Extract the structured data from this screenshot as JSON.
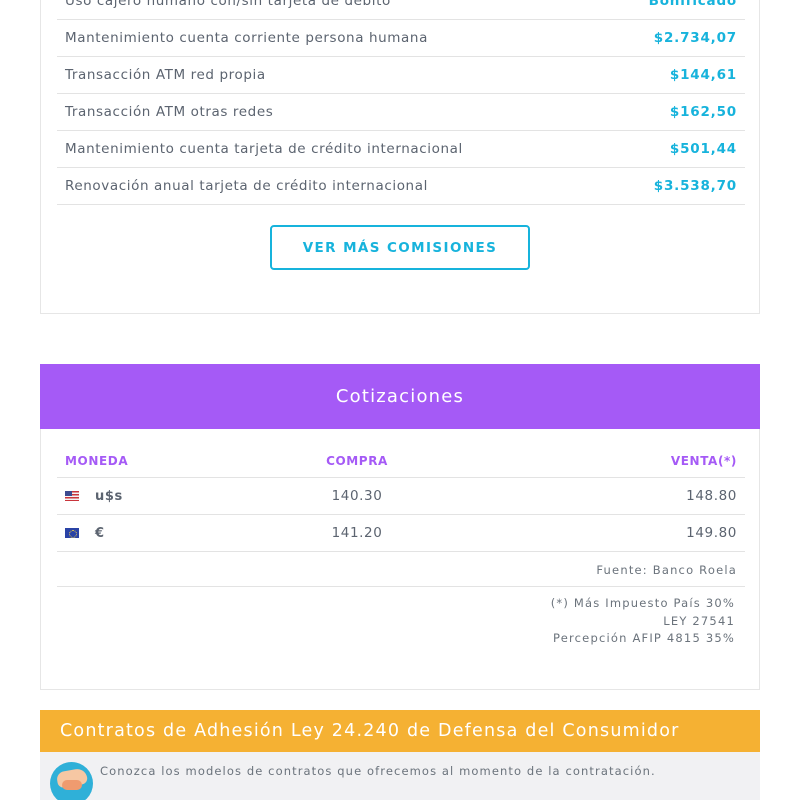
{
  "fees": {
    "rows": [
      {
        "name": "Uso cajero humano con/sin tarjeta de débito",
        "value": "Bonificado"
      },
      {
        "name": "Mantenimiento cuenta corriente persona humana",
        "value": "$2.734,07"
      },
      {
        "name": "Transacción ATM red propia",
        "value": "$144,61"
      },
      {
        "name": "Transacción ATM otras redes",
        "value": "$162,50"
      },
      {
        "name": "Mantenimiento cuenta tarjeta de crédito internacional",
        "value": "$501,44"
      },
      {
        "name": "Renovación anual tarjeta de crédito internacional",
        "value": "$3.538,70"
      }
    ],
    "more_button": "VER MÁS COMISIONES"
  },
  "quotes": {
    "title": "Cotizaciones",
    "headers": {
      "currency": "MONEDA",
      "buy": "COMPRA",
      "sell": "VENTA(*)"
    },
    "rows": [
      {
        "flag": "us-flag-icon",
        "symbol": "u$s",
        "buy": "140.30",
        "sell": "148.80"
      },
      {
        "flag": "eu-flag-icon",
        "symbol": "€",
        "buy": "141.20",
        "sell": "149.80"
      }
    ],
    "source": "Fuente: Banco Roela",
    "notes": [
      "(*) Más Impuesto País 30%",
      "LEY 27541",
      "Percepción AFIP 4815 35%"
    ]
  },
  "contracts": {
    "title": "Contratos de Adhesión Ley 24.240 de Defensa del Consumidor",
    "text": "Conozca los modelos de contratos que ofrecemos al momento de la contratación.",
    "icon": "handshake-icon"
  },
  "colors": {
    "accent_blue": "#17b3dc",
    "quotes_purple": "#a55af6",
    "contracts_orange": "#f5b133"
  }
}
